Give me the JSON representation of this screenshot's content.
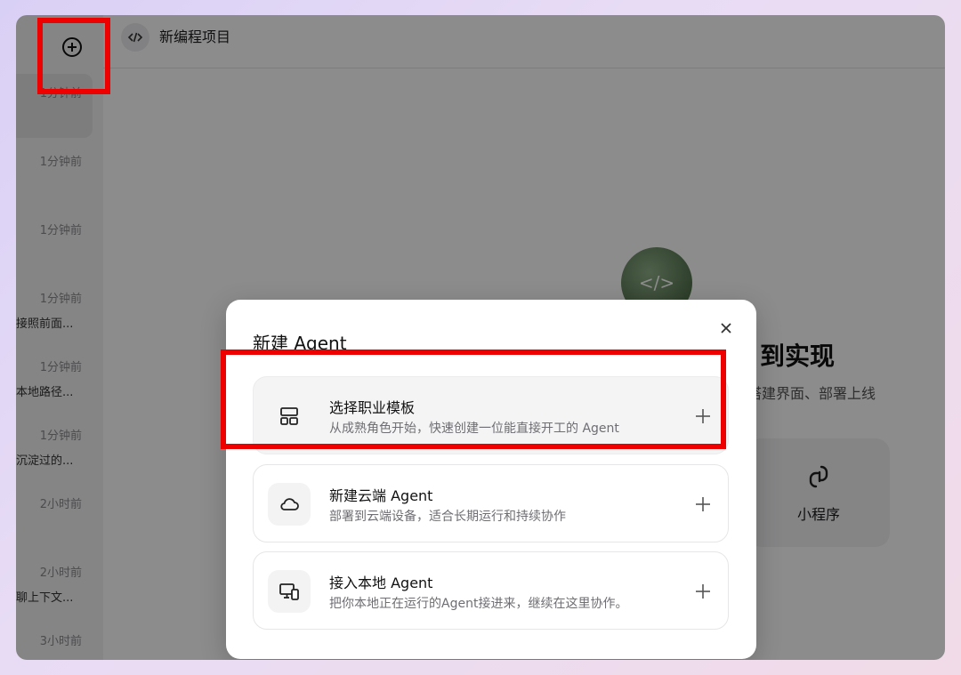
{
  "sidebar": {
    "new_button": "plus-circle-icon",
    "items": [
      {
        "time": "1分钟前",
        "title": ""
      },
      {
        "time": "1分钟前",
        "title": ""
      },
      {
        "time": "1分钟前",
        "title": ""
      },
      {
        "time": "1分钟前",
        "title": "接照前面..."
      },
      {
        "time": "1分钟前",
        "title": "本地路径..."
      },
      {
        "time": "1分钟前",
        "title": "沉淀过的..."
      },
      {
        "time": "2小时前",
        "title": ""
      },
      {
        "time": "2小时前",
        "title": "聊上下文..."
      },
      {
        "time": "3小时前",
        "title": ""
      }
    ]
  },
  "header": {
    "icon": "code-icon",
    "title": "新编程项目"
  },
  "background": {
    "hero_title": "到实现",
    "hero_subtitle": "搭建界面、部署上线",
    "mini_card_label": "小程序"
  },
  "modal": {
    "title": "新建 Agent",
    "close_icon": "close-icon",
    "options": [
      {
        "title": "选择职业模板",
        "desc": "从成熟角色开始，快速创建一位能直接开工的 Agent",
        "icon": "template-icon"
      },
      {
        "title": "新建云端 Agent",
        "desc": "部署到云端设备，适合长期运行和持续协作",
        "icon": "cloud-icon"
      },
      {
        "title": "接入本地 Agent",
        "desc": "把你本地正在运行的Agent接进来，继续在这里协作。",
        "icon": "local-device-icon"
      }
    ]
  },
  "colors": {
    "highlight": "#ee0000",
    "overlay": "rgba(0,0,0,0.45)"
  }
}
